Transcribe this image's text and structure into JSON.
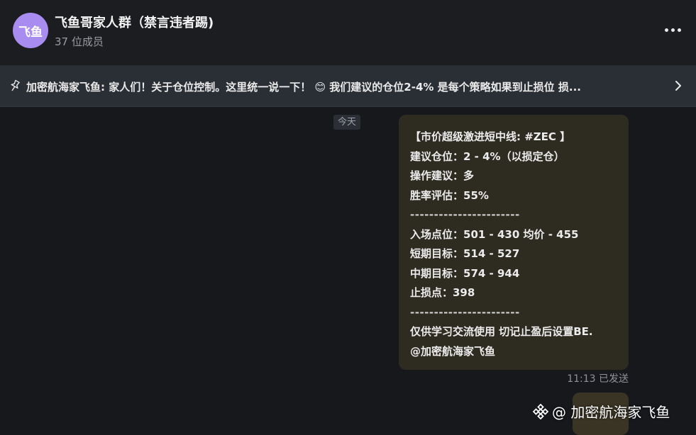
{
  "header": {
    "avatar_text": "飞鱼",
    "title": "飞鱼哥家人群（禁言违者踢)",
    "member_count": "37 位成员"
  },
  "pinned": {
    "text": "加密航海家飞鱼: 家人们！关于仓位控制。这里统一说一下！ 😊 我们建议的仓位2-4% 是每个策略如果到止损位 损..."
  },
  "date_separator": "今天",
  "message": {
    "lines": [
      "【市价超级激进短中线: #ZEC 】",
      "建议仓位：2 - 4%（以损定仓）",
      "操作建议：多",
      "胜率评估：55%",
      "-----------------------",
      "入场点位：501 - 430 均价 - 455",
      "短期目标：514 - 527",
      "中期目标：574 - 944",
      "止损点：398",
      "-----------------------",
      "仅供学习交流使用 切记止盈后设置BE.",
      " @加密航海家飞鱼"
    ],
    "time": "11:13",
    "status": "已发送"
  },
  "watermark": {
    "text": "@ 加密航海家飞鱼"
  },
  "colors": {
    "background": "#17181c",
    "header": "#1c1d21",
    "pinned_bar": "#2a2e35",
    "bubble": "#2e2b21",
    "avatar": "#a98cf0"
  }
}
